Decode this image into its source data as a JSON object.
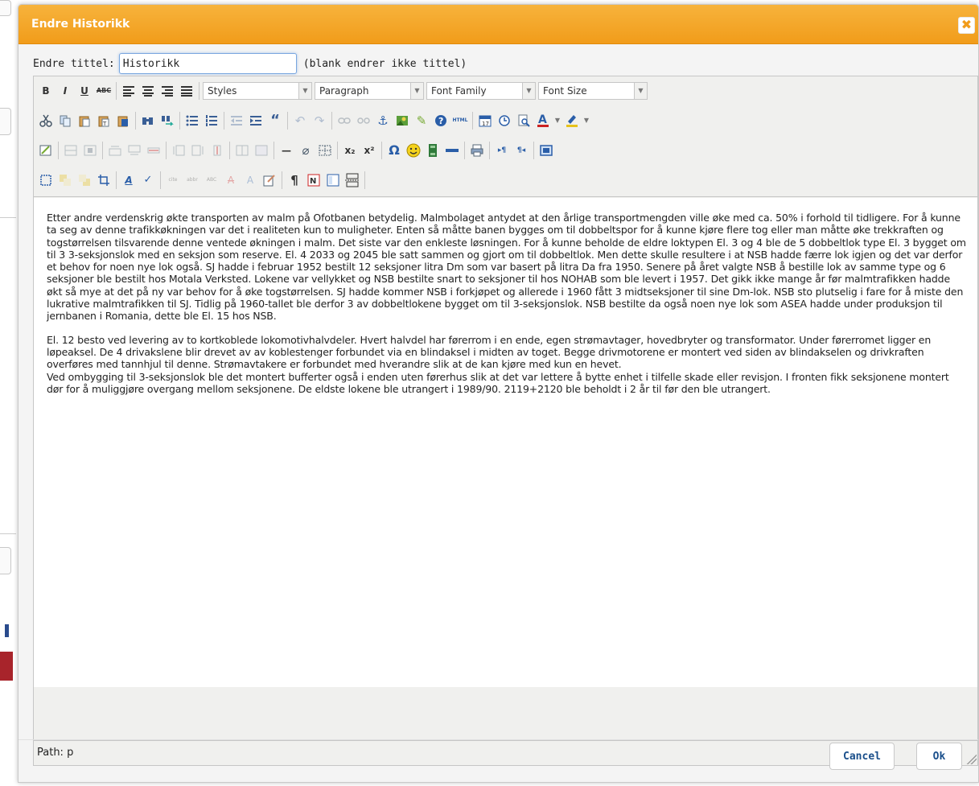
{
  "dialog": {
    "title": "Endre Historikk",
    "close_glyph": "✖"
  },
  "title_field": {
    "label": "Endre tittel:",
    "value": "Historikk",
    "hint": "(blank endrer ikke tittel)"
  },
  "toolbar": {
    "bold": "B",
    "italic": "I",
    "underline": "U",
    "strike": "ABC",
    "styles_label": "Styles",
    "format_label": "Paragraph",
    "font_family_label": "Font Family",
    "font_size_label": "Font Size",
    "row2_icons": [
      "cut-icon",
      "copy-icon",
      "paste-icon",
      "paste-text-icon",
      "paste-word-icon",
      "find-icon",
      "replace-icon",
      "bullet-list-icon",
      "numbered-list-icon",
      "outdent-icon",
      "indent-icon",
      "blockquote-icon",
      "undo-icon",
      "redo-icon",
      "link-icon",
      "unlink-icon",
      "anchor-icon",
      "image-icon",
      "cleanup-icon",
      "help-icon",
      "html-icon",
      "insert-date-icon",
      "insert-time-icon",
      "preview-icon",
      "forecolor-icon",
      "backcolor-icon"
    ],
    "row3_icons": [
      "table-icon",
      "row-props-icon",
      "cell-props-icon",
      "insert-row-before-icon",
      "insert-row-after-icon",
      "delete-row-icon",
      "insert-col-before-icon",
      "insert-col-after-icon",
      "delete-col-icon",
      "split-cells-icon",
      "merge-cells-icon",
      "horizontal-rule-icon",
      "remove-format-icon",
      "visual-aid-icon",
      "subscript-icon",
      "superscript-icon",
      "charmap-icon",
      "emotions-icon",
      "media-icon",
      "advhr-icon",
      "print-icon",
      "ltr-icon",
      "rtl-icon",
      "fullscreen-icon"
    ],
    "row4_icons": [
      "insert-layer-icon",
      "move-forward-icon",
      "move-backward-icon",
      "absolute-icon",
      "style-props-icon",
      "spellcheck-icon",
      "cite-icon",
      "abbr-icon",
      "acronym-icon",
      "del-icon",
      "ins-icon",
      "attribs-icon",
      "visual-chars-icon",
      "nonbreaking-icon",
      "template-icon",
      "pagebreak-icon"
    ],
    "sub_label": "x₂",
    "sup_label": "x²",
    "omega_label": "Ω",
    "emoji_label": "☺",
    "pilcrow_label": "¶",
    "ltr_label": "▸¶",
    "rtl_label": "¶◂",
    "html_label": "HTML",
    "quote_label": "“",
    "hr_label": "—"
  },
  "content": {
    "paragraph_1": "Etter andre verdenskrig økte transporten av malm på Ofotbanen betydelig. Malmbolaget antydet at den årlige transportmengden ville øke med ca. 50% i forhold til tidligere. For å kunne ta seg av denne trafikkøkningen var det i realiteten kun to muligheter. Enten så måtte banen bygges om til dobbeltspor for å kunne kjøre flere tog eller man måtte øke trekkraften og togstørrelsen tilsvarende denne ventede økningen i malm. Det siste var den enkleste løsningen. For å kunne beholde de eldre loktypen El. 3 og 4 ble de 5 dobbeltlok type El. 3 bygget om til 3 3-seksjonslok med en seksjon som reserve. El. 4 2033 og 2045 ble satt sammen og gjort om til dobbeltlok. Men dette skulle resultere i at NSB hadde færre lok igjen og det var derfor et behov for noen nye lok også. SJ hadde i februar 1952 bestilt 12 seksjoner litra Dm som var basert på litra Da fra 1950. Senere på året valgte NSB å bestille lok av samme type og 6 seksjoner ble bestilt hos Motala Verksted. Lokene var vellykket og NSB bestilte snart to seksjoner til hos NOHAB som ble levert i 1957. Det gikk ikke mange år før malmtrafikken hadde økt så mye at det på ny var behov for å øke togstørrelsen. SJ hadde kommer NSB i forkjøpet og allerede i 1960 fått 3 midtseksjoner til sine Dm-lok. NSB sto plutselig i fare for å miste den lukrative malmtrafikken til SJ. Tidlig på 1960-tallet ble derfor 3 av dobbeltlokene bygget om til 3-seksjonslok. NSB bestilte da også noen nye lok som ASEA hadde under produksjon til jernbanen i Romania, dette ble El. 15 hos NSB.",
    "paragraph_2a": "El. 12 besto ved levering av to kortkoblede lokomotivhalvdeler. Hvert halvdel har førerrom i en ende, egen strømavtager, hovedbryter og transformator. Under førerromet ligger en løpeaksel. De 4 drivakslene blir drevet av av koblestenger forbundet via en blindaksel i midten av toget. Begge drivmotorene er montert ved siden av blindakselen og drivkraften overføres med tannhjul til denne. Strømavtakere er forbundet med hverandre slik at de kan kjøre med kun en hevet.",
    "paragraph_2b": "Ved ombygging til 3-seksjonslok ble det montert bufferter også i enden uten førerhus slik at det var lettere å bytte enhet i tilfelle skade eller revisjon. I fronten fikk seksjonene montert dør for å muliggjøre overgang mellom seksjonene. De eldste lokene ble utrangert i 1989/90. 2119+2120 ble beholdt i 2 år til før den ble utrangert."
  },
  "statusbar": {
    "path": "Path: p"
  },
  "buttons": {
    "cancel": "Cancel",
    "ok": "Ok"
  },
  "colors": {
    "titlebar": "#f19c1a",
    "button_text": "#1a4f8b"
  }
}
